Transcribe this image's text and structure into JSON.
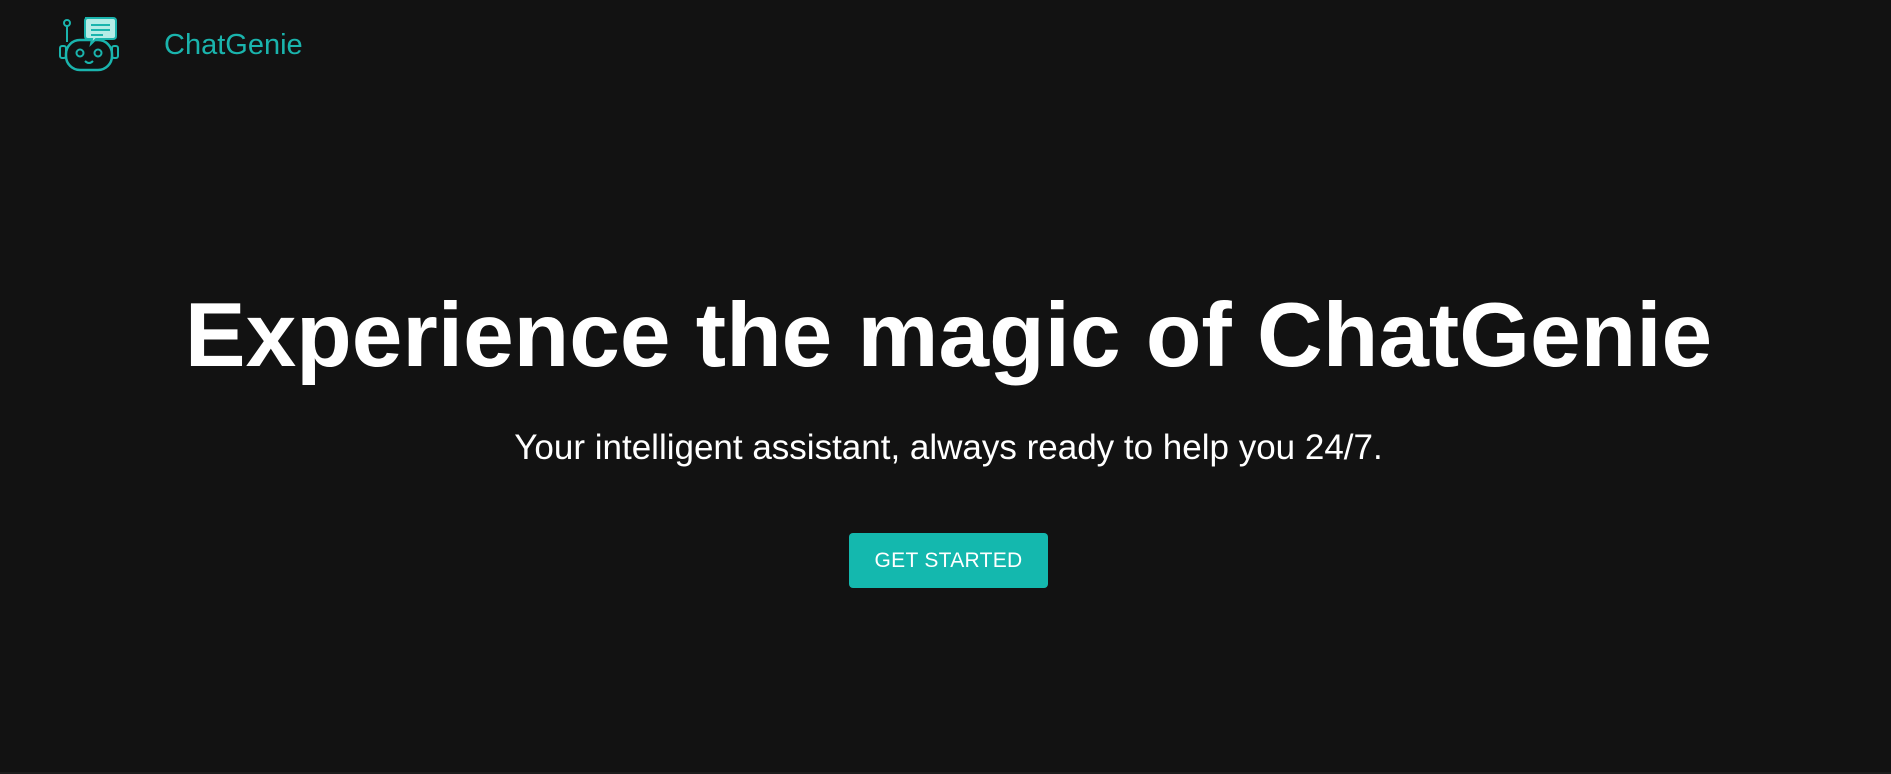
{
  "header": {
    "logo_icon": "robot-chat-icon",
    "brand": "ChatGenie"
  },
  "hero": {
    "title": "Experience the magic of ChatGenie",
    "subtitle": "Your intelligent assistant, always ready to help you 24/7.",
    "cta_label": "GET STARTED"
  },
  "colors": {
    "background": "#121212",
    "accent": "#14b8ae",
    "text": "#ffffff"
  }
}
